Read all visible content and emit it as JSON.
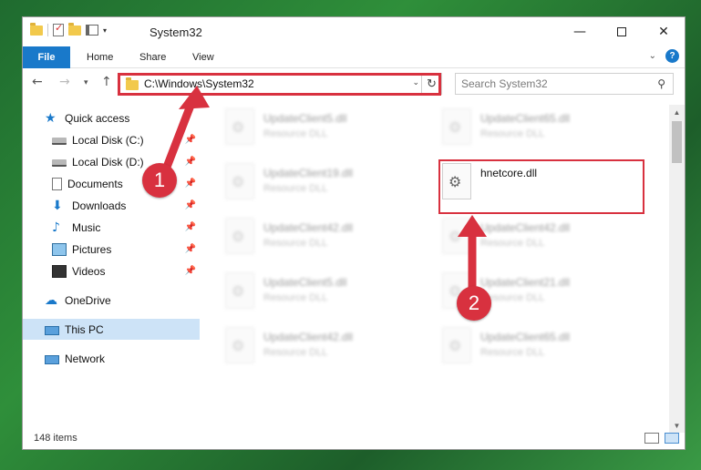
{
  "window": {
    "title": "System32"
  },
  "ribbon": {
    "tabs": [
      "File",
      "Home",
      "Share",
      "View"
    ]
  },
  "address": {
    "path": "C:\\Windows\\System32",
    "refresh_icon": "refresh-icon",
    "dropdown_icon": "chevron-down-icon"
  },
  "search": {
    "placeholder": "Search System32"
  },
  "sidebar": {
    "items": [
      {
        "label": "Quick access",
        "icon": "star-icon"
      },
      {
        "label": "Local Disk (C:)",
        "icon": "disk-icon",
        "pinned": true
      },
      {
        "label": "Local Disk (D:)",
        "icon": "disk-icon",
        "pinned": true
      },
      {
        "label": "Documents",
        "icon": "documents-icon",
        "pinned": true
      },
      {
        "label": "Downloads",
        "icon": "downloads-icon",
        "pinned": true
      },
      {
        "label": "Music",
        "icon": "music-icon",
        "pinned": true
      },
      {
        "label": "Pictures",
        "icon": "pictures-icon",
        "pinned": true
      },
      {
        "label": "Videos",
        "icon": "videos-icon",
        "pinned": true
      },
      {
        "label": "OneDrive",
        "icon": "cloud-icon"
      },
      {
        "label": "This PC",
        "icon": "computer-icon",
        "selected": true
      },
      {
        "label": "Network",
        "icon": "network-icon"
      }
    ]
  },
  "files": {
    "left_column": [
      {
        "name": "UpdateClient5.dll",
        "type": "Resource DLL"
      },
      {
        "name": "UpdateClient19.dll",
        "type": "Resource DLL"
      },
      {
        "name": "UpdateClient42.dll",
        "type": "Resource DLL"
      },
      {
        "name": "UpdateClient5.dll",
        "type": "Resource DLL"
      },
      {
        "name": "UpdateClient42.dll",
        "type": "Resource DLL"
      }
    ],
    "right_column": [
      {
        "name": "UpdateClient65.dll",
        "type": "Resource DLL"
      },
      {
        "name": "hnetcore.dll",
        "type": ""
      },
      {
        "name": "UpdateClient42.dll",
        "type": "Resource DLL"
      },
      {
        "name": "UpdateClient21.dll",
        "type": "Resource DLL"
      },
      {
        "name": "UpdateClient65.dll",
        "type": "Resource DLL"
      }
    ]
  },
  "status": {
    "count": "148 items"
  },
  "annotations": {
    "step1": "1",
    "step2": "2",
    "color": "#d8313f"
  },
  "colors": {
    "accent": "#1979ca",
    "selection": "#cde3f7"
  }
}
